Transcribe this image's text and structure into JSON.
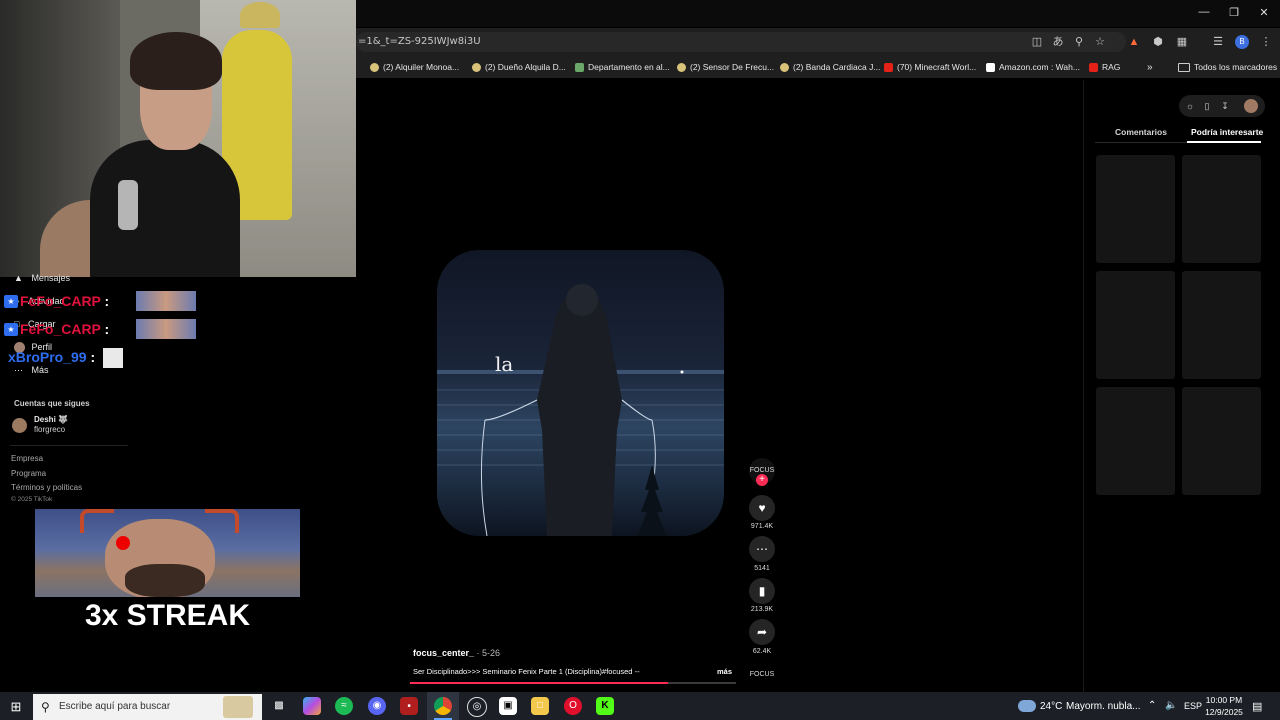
{
  "browser": {
    "url_fragment": "=1&_t=ZS-925IWJw8i3U",
    "profile_initial": "B",
    "bookmarks": [
      {
        "label": "(2) Alquiler Monoa...",
        "icon": "face-icon"
      },
      {
        "label": "(2) Dueño Alquila D...",
        "icon": "face-icon"
      },
      {
        "label": "Departamento en al...",
        "icon": "image-icon"
      },
      {
        "label": "(2) Sensor De Frecu...",
        "icon": "face-icon"
      },
      {
        "label": "(2) Banda Cardiaca J...",
        "icon": "face-icon"
      },
      {
        "label": "(70) Minecraft Worl...",
        "icon": "youtube-icon"
      },
      {
        "label": "Amazon.com : Wah...",
        "icon": "amazon-icon"
      },
      {
        "label": "RAG",
        "icon": "youtube-icon"
      }
    ],
    "bookmarks_more": "»",
    "all_bookmarks": "Todos los marcadores"
  },
  "sidebar": {
    "nav": [
      {
        "label": "Mensajes",
        "icon": "paper-plane-icon"
      },
      {
        "label": "Actividad",
        "icon": "bell-icon"
      },
      {
        "label": "Cargar",
        "icon": "upload-icon"
      },
      {
        "label": "Perfil",
        "icon": "avatar-icon"
      },
      {
        "label": "Más",
        "icon": "more-icon"
      }
    ],
    "following_title": "Cuentas que sigues",
    "following": [
      {
        "name": "Deshi 🐺",
        "handle": "florgreco"
      }
    ],
    "footer_links": [
      "Empresa",
      "Programa",
      "Términos y políticas"
    ],
    "copyright": "© 2025 TikTok"
  },
  "overlay": {
    "chat": [
      {
        "name": "FeFo_CARP",
        "color": "#e0123c"
      },
      {
        "name": "FeFo_CARP",
        "color": "#e0123c"
      },
      {
        "name": "xBroPro_99",
        "color": "#2f6df0"
      }
    ],
    "streak_text": "3x STREAK"
  },
  "video": {
    "caption_word": "la",
    "author": "focus_center_",
    "date": "· 5-26",
    "description": "Ser Disciplinado>>> Seminario Fenix Parte 1 (Disciplina)#focused --",
    "more": "más",
    "progress": 0.79,
    "avatar_text": "FOCUS",
    "likes": "971.4K",
    "comments": "5141",
    "saves": "213.9K",
    "shares": "62.4K"
  },
  "panel": {
    "tabs": [
      "Comentarios",
      "Podría interesarte"
    ],
    "active_tab": 1
  },
  "taskbar": {
    "search_placeholder": "Escribe aquí para buscar",
    "weather_temp": "24°C",
    "weather_desc": "Mayorm. nubla...",
    "language": "ESP",
    "time": "10:00 PM",
    "date": "12/9/2025"
  },
  "colors": {
    "accent": "#fe2c55",
    "chat_red": "#e0123c",
    "chat_blue": "#2f6df0"
  }
}
